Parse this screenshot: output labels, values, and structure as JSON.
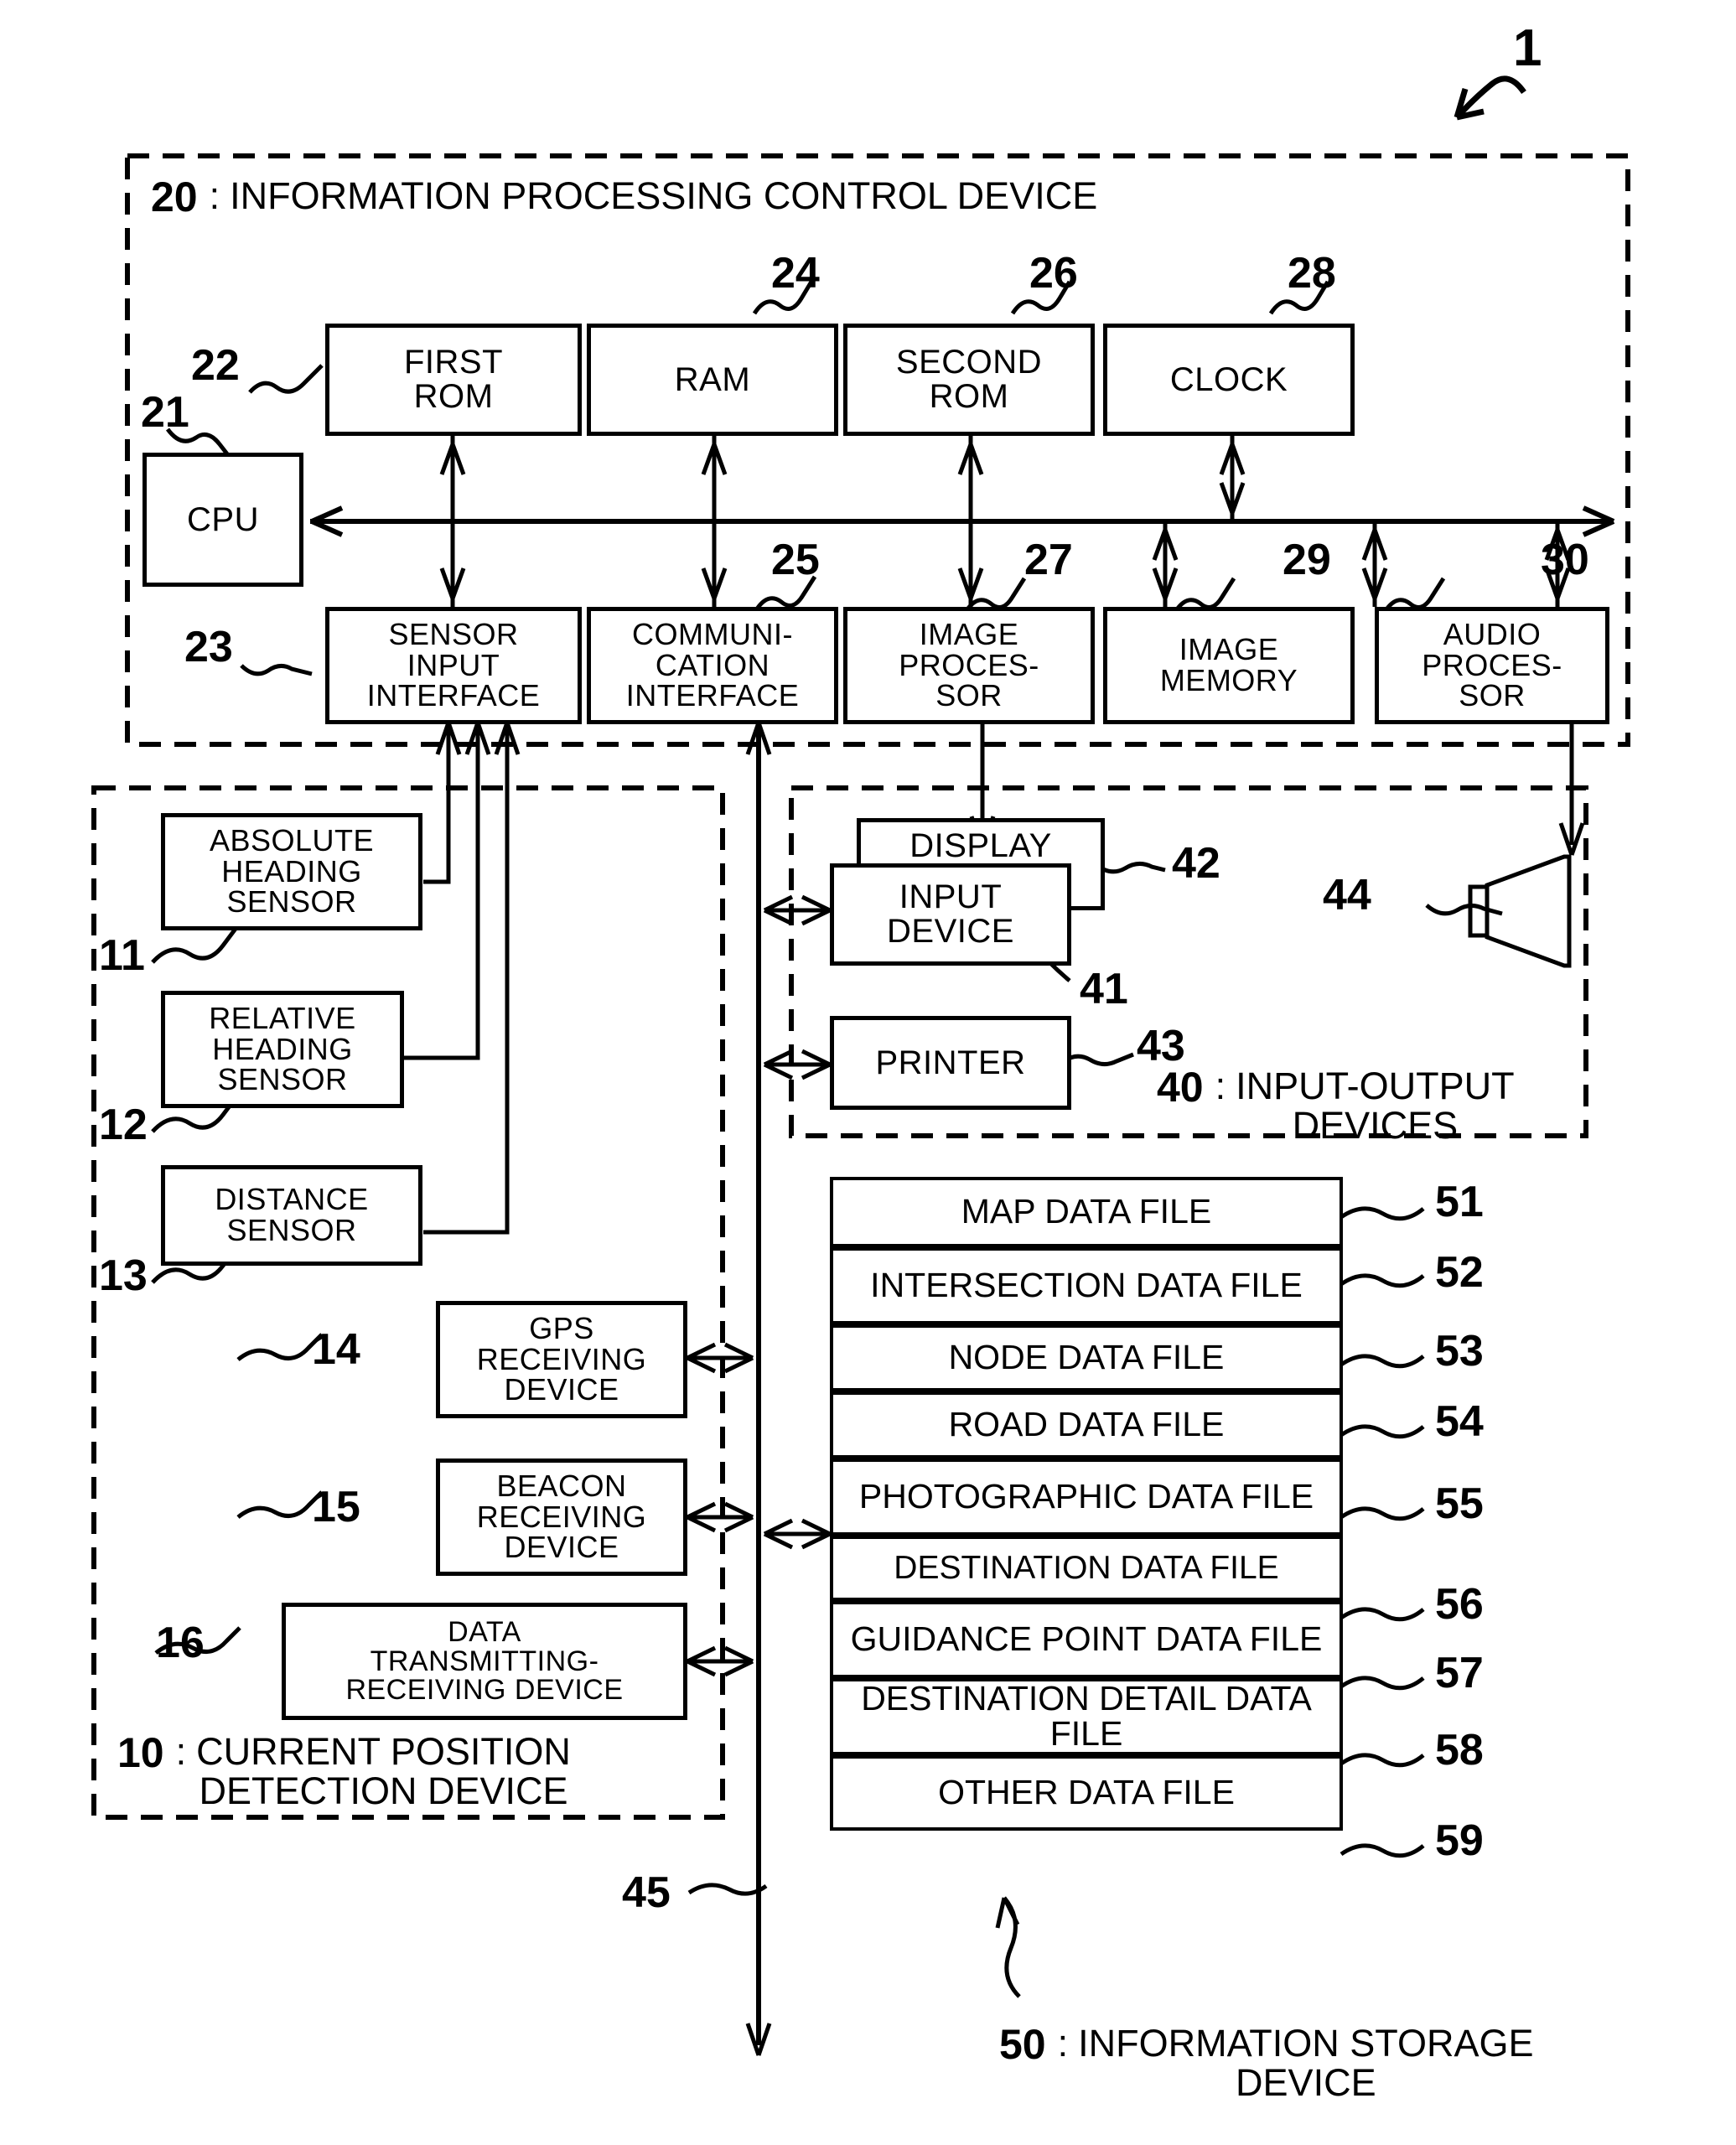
{
  "figure": {
    "top_numeral": "1",
    "sections": {
      "control_device": {
        "num": "20",
        "sep": ":",
        "label": "INFORMATION PROCESSING CONTROL DEVICE"
      },
      "position_device": {
        "num": "10",
        "sep": ":",
        "label_line1": "CURRENT POSITION",
        "label_line2": "DETECTION DEVICE"
      },
      "io_devices": {
        "num": "40",
        "sep": ":",
        "label_line1": "INPUT-OUTPUT",
        "label_line2": "DEVICES"
      },
      "storage_device": {
        "num": "50",
        "sep": ":",
        "label_line1": "INFORMATION STORAGE",
        "label_line2": "DEVICE"
      }
    }
  },
  "control_device": {
    "top_row": [
      {
        "num": "22",
        "label_lines": [
          "FIRST",
          "ROM"
        ]
      },
      {
        "num": "24",
        "label_lines": [
          "RAM"
        ]
      },
      {
        "num": "26",
        "label_lines": [
          "SECOND",
          "ROM"
        ]
      },
      {
        "num": "28",
        "label_lines": [
          "CLOCK"
        ]
      }
    ],
    "cpu": {
      "num": "21",
      "label_lines": [
        "CPU"
      ]
    },
    "bottom_row": [
      {
        "num": "23",
        "label_lines": [
          "SENSOR",
          "INPUT",
          "INTERFACE"
        ]
      },
      {
        "num": "25",
        "label_lines": [
          "COMMUNI-",
          "CATION",
          "INTERFACE"
        ]
      },
      {
        "num": "27",
        "label_lines": [
          "IMAGE",
          "PROCES-",
          "SOR"
        ]
      },
      {
        "num": "29",
        "label_lines": [
          "IMAGE",
          "MEMORY"
        ]
      },
      {
        "num": "30",
        "label_lines": [
          "AUDIO",
          "PROCES-",
          "SOR"
        ]
      }
    ]
  },
  "position_device": {
    "sensors": [
      {
        "num": "11",
        "label_lines": [
          "ABSOLUTE",
          "HEADING",
          "SENSOR"
        ]
      },
      {
        "num": "12",
        "label_lines": [
          "RELATIVE",
          "HEADING",
          "SENSOR"
        ]
      },
      {
        "num": "13",
        "label_lines": [
          "DISTANCE",
          "SENSOR"
        ]
      },
      {
        "num": "14",
        "label_lines": [
          "GPS",
          "RECEIVING",
          "DEVICE"
        ]
      },
      {
        "num": "15",
        "label_lines": [
          "BEACON",
          "RECEIVING",
          "DEVICE"
        ]
      },
      {
        "num": "16",
        "label_lines": [
          "DATA",
          "TRANSMITTING-",
          "RECEIVING DEVICE"
        ]
      }
    ]
  },
  "io_devices": {
    "items": [
      {
        "num": "42",
        "label_lines": [
          "DISPLAY"
        ]
      },
      {
        "num": "41",
        "label_lines": [
          "INPUT",
          "DEVICE"
        ]
      },
      {
        "num": "43",
        "label_lines": [
          "PRINTER"
        ]
      },
      {
        "num": "44",
        "label_lines": [
          ""
        ],
        "icon": "speaker-icon"
      }
    ]
  },
  "storage_device": {
    "files": [
      {
        "num": "51",
        "label_lines": [
          "MAP DATA FILE"
        ]
      },
      {
        "num": "52",
        "label_lines": [
          "INTERSECTION",
          "DATA FILE"
        ]
      },
      {
        "num": "53",
        "label_lines": [
          "NODE DATA FILE"
        ]
      },
      {
        "num": "54",
        "label_lines": [
          "ROAD DATA FILE"
        ]
      },
      {
        "num": "55",
        "label_lines": [
          "PHOTOGRAPHIC",
          "DATA FILE"
        ]
      },
      {
        "num": "56",
        "label_lines": [
          "DESTINATION DATA FILE"
        ]
      },
      {
        "num": "57",
        "label_lines": [
          "GUIDANCE POINT",
          "DATA FILE"
        ]
      },
      {
        "num": "58",
        "label_lines": [
          "DESTINATION DETAIL",
          "DATA FILE"
        ]
      },
      {
        "num": "59",
        "label_lines": [
          "OTHER DATA FILE"
        ]
      }
    ]
  },
  "bus": {
    "num": "45"
  },
  "colors": {
    "line": "#000000",
    "background": "#ffffff"
  }
}
